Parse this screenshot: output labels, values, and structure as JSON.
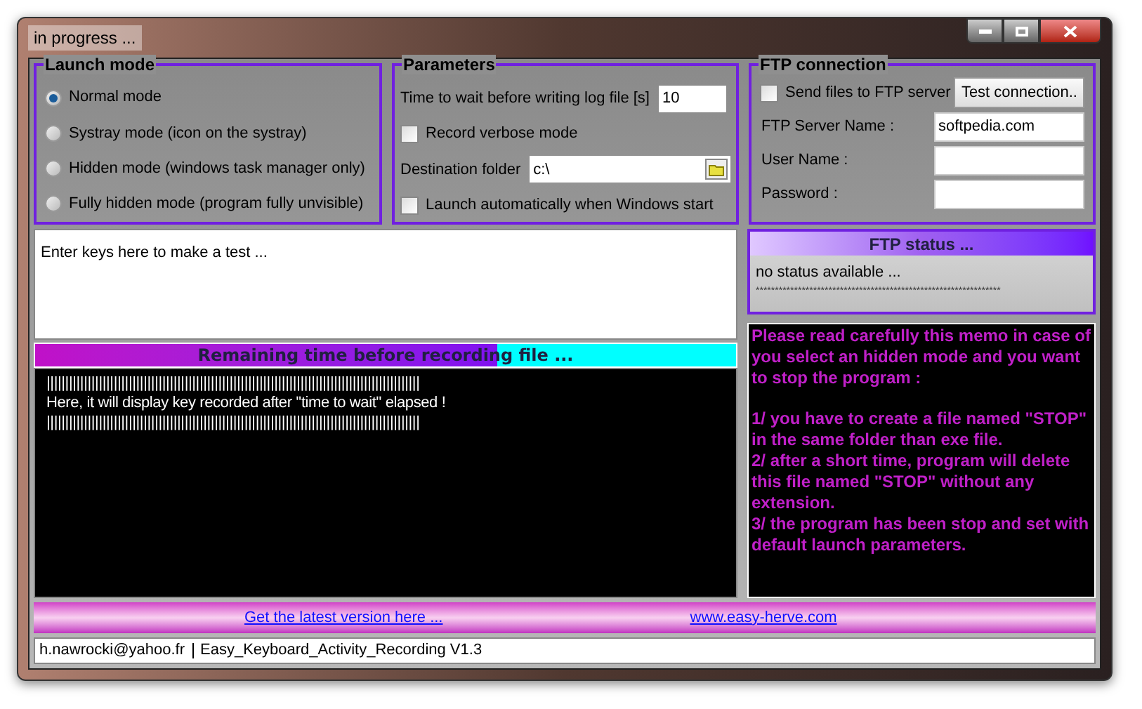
{
  "window": {
    "title": "in progress ..."
  },
  "launch_mode": {
    "title": "Launch mode",
    "options": [
      {
        "label": "Normal mode",
        "selected": true
      },
      {
        "label": "Systray mode (icon on the systray)",
        "selected": false
      },
      {
        "label": "Hidden mode (windows task manager only)",
        "selected": false
      },
      {
        "label": "Fully hidden mode (program fully unvisible)",
        "selected": false
      }
    ]
  },
  "parameters": {
    "title": "Parameters",
    "wait_label": "Time to wait before writing log file [s]",
    "wait_value": "10",
    "verbose": {
      "label": "Record verbose mode",
      "checked": false
    },
    "folder_label": "Destination folder",
    "folder_value": "c:\\",
    "autostart": {
      "label": "Launch automatically when Windows start",
      "checked": false
    }
  },
  "ftp_connection": {
    "title": "FTP connection",
    "send": {
      "label": "Send files to FTP server",
      "checked": false
    },
    "test_button": "Test connection..",
    "fields": [
      {
        "label": "FTP Server Name :",
        "value": "softpedia.com"
      },
      {
        "label": "User Name :"
      },
      {
        "label": "Password :"
      }
    ]
  },
  "test_area": {
    "text": "Enter keys here to make a test ..."
  },
  "ftp_status": {
    "title": "FTP status ...",
    "text": "no status available ...",
    "rule": "****************************************************************"
  },
  "progress": {
    "label": "Remaining time before recording file ...",
    "level": 0.66
  },
  "log": {
    "lines": [
      "||||||||||||||||||||||||||||||||||||||||||||||||||||||||||||||||||||||||||||||||||||||||||||||||||||",
      "Here, it will display key recorded after ''time to wait'' elapsed !",
      "||||||||||||||||||||||||||||||||||||||||||||||||||||||||||||||||||||||||||||||||||||||||||||||||||||"
    ]
  },
  "memo": {
    "paragraphs": [
      "Please read carefully this memo in case of you select an hidden mode and you want to stop the program :",
      "1/ you have to create a file named \"STOP\" in the same folder than exe file.\n2/ after a short time, program will delete this file named \"STOP\" without any extension.\n3/ the program has been stop and set with default launch parameters."
    ]
  },
  "links": [
    "Get the latest version here ...",
    "www.easy-herve.com"
  ],
  "status_bar": {
    "email": "h.nawrocki@yahoo.fr",
    "app": "Easy_Keyboard_Activity_Recording V1.3"
  }
}
